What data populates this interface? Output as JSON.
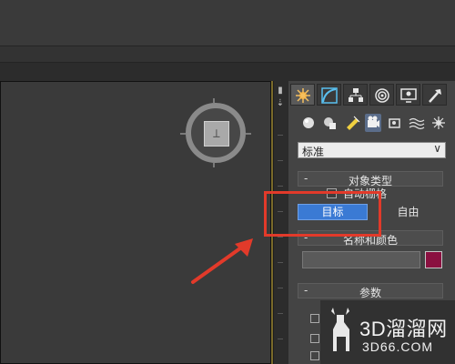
{
  "viewcube": {
    "face_glyph": "⊥"
  },
  "command_panel": {
    "tabs": [
      {
        "icon": "create-icon",
        "active": true
      },
      {
        "icon": "modify-icon"
      },
      {
        "icon": "hierarchy-icon"
      },
      {
        "icon": "motion-icon"
      },
      {
        "icon": "display-icon"
      },
      {
        "icon": "utilities-icon"
      }
    ],
    "subcategories": [
      {
        "icon": "geometry-icon"
      },
      {
        "icon": "shapes-icon"
      },
      {
        "icon": "lights-icon"
      },
      {
        "icon": "cameras-icon",
        "active": true
      },
      {
        "icon": "helpers-icon"
      },
      {
        "icon": "space-warps-icon"
      },
      {
        "icon": "systems-icon"
      }
    ],
    "category_dropdown": {
      "value": "标准"
    },
    "rollout_object_type": {
      "title": "对象类型",
      "collapse_symbol": "-",
      "autogrid_label": "自动栅格",
      "buttons": [
        "目标",
        "自由"
      ],
      "active_button": "目标"
    },
    "rollout_name_color": {
      "title": "名称和颜色",
      "collapse_symbol": "-",
      "name_value": "",
      "color": "#8a1040"
    },
    "rollout_parameters": {
      "title": "参数",
      "collapse_symbol": "-"
    }
  },
  "accent_colors": {
    "highlight": "#e23a2a",
    "selected_button": "#3a7ad4"
  },
  "watermark": {
    "text": "3D溜溜网",
    "url": "3D66.COM"
  }
}
